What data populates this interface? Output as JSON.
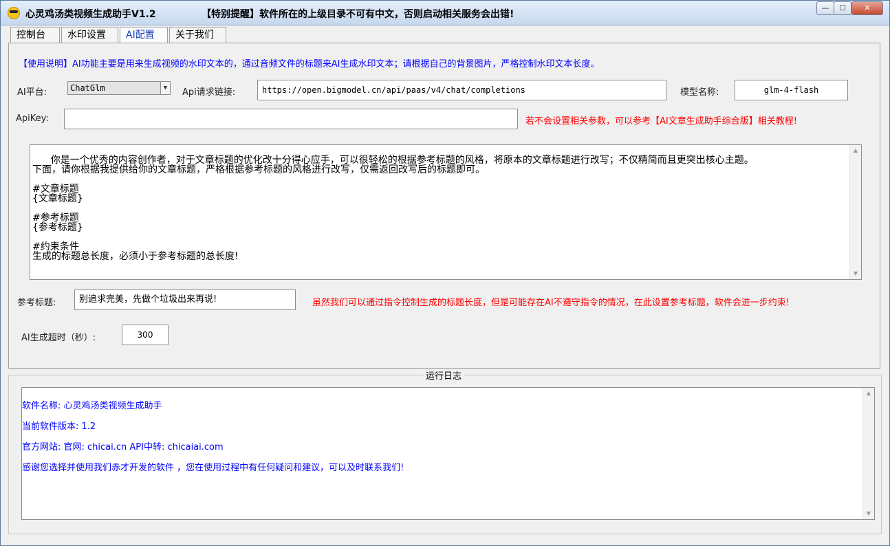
{
  "window": {
    "title": "心灵鸡汤类视频生成助手V1.2",
    "notice": "【特别提醒】软件所在的上级目录不可有中文，否则启动相关服务会出错!",
    "controls": {
      "minimize": "—",
      "maximize": "☐",
      "close": "✕"
    }
  },
  "tabs": [
    {
      "label": "控制台"
    },
    {
      "label": "水印设置"
    },
    {
      "label": "AI配置",
      "active": true
    },
    {
      "label": "关于我们"
    }
  ],
  "ai_config": {
    "usage_note": "【使用说明】AI功能主要是用来生成视频的水印文本的，通过音频文件的标题来AI生成水印文本；请根据自己的背景图片，严格控制水印文本长度。",
    "platform_label": "AI平台:",
    "platform_value": "ChatGlm",
    "api_url_label": "Api请求链接:",
    "api_url_value": "https://open.bigmodel.cn/api/paas/v4/chat/completions",
    "model_label": "模型名称:",
    "model_value": "glm-4-flash",
    "apikey_label": "ApiKey:",
    "apikey_value": "",
    "apikey_hint": "若不会设置相关参数，可以参考【AI文章生成助手综合版】相关教程!",
    "prompt_text": "你是一个优秀的内容创作者，对于文章标题的优化改十分得心应手，可以很轻松的根据参考标题的风格，将原本的文章标题进行改写；不仅精简而且更突出核心主题。\n下面，请你根据我提供给你的文章标题，严格根据参考标题的风格进行改写，仅需返回改写后的标题即可。\n\n#文章标题\n{文章标题}\n\n#参考标题\n{参考标题}\n\n#约束条件\n生成的标题总长度，必须小于参考标题的总长度!",
    "ref_title_label": "参考标题:",
    "ref_title_value": "别追求完美，先做个垃圾出来再说!",
    "ref_title_hint": "虽然我们可以通过指令控制生成的标题长度，但是可能存在AI不遵守指令的情况，在此设置参考标题，软件会进一步约束!",
    "timeout_label": "AI生成超时（秒）:",
    "timeout_value": "300"
  },
  "log": {
    "caption": "运行日志",
    "lines": [
      "软件名称: 心灵鸡汤类视频生成助手",
      "当前软件版本: 1.2",
      "官方网站: 官网: chicai.cn  API中转: chicaiai.com",
      "感谢您选择并使用我们赤才开发的软件 ，您在使用过程中有任何疑问和建议，可以及时联系我们!"
    ]
  }
}
